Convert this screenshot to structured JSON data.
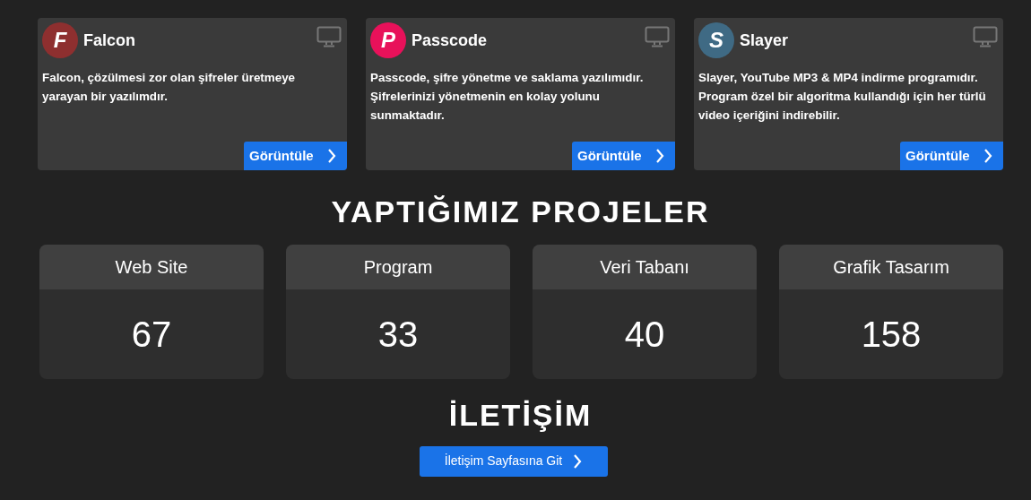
{
  "apps": [
    {
      "logo_letter": "F",
      "color": "#8e2f2f",
      "name": "Falcon",
      "description": "Falcon, çözülmesi zor olan şifreler üretmeye yarayan bir yazılımdır.",
      "button": "Görüntüle"
    },
    {
      "logo_letter": "P",
      "color": "#e8115a",
      "name": "Passcode",
      "description": "Passcode, şifre yönetme ve saklama yazılımıdır. Şifrelerinizi yönetmenin en kolay yolunu sunmaktadır.",
      "button": "Görüntüle"
    },
    {
      "logo_letter": "S",
      "color": "#3f6a84",
      "name": "Slayer",
      "description": "Slayer, YouTube MP3 & MP4 indirme programıdır. Program özel bir algoritma kullandığı için her türlü video içeriğini indirebilir.",
      "button": "Görüntüle"
    }
  ],
  "projects": {
    "title": "YAPTIĞIMIZ PROJELER",
    "stats": [
      {
        "label": "Web Site",
        "value": "67"
      },
      {
        "label": "Program",
        "value": "33"
      },
      {
        "label": "Veri Tabanı",
        "value": "40"
      },
      {
        "label": "Grafik Tasarım",
        "value": "158"
      }
    ]
  },
  "contact": {
    "title": "İLETİŞİM",
    "button": "İletişim Sayfasına Git"
  }
}
